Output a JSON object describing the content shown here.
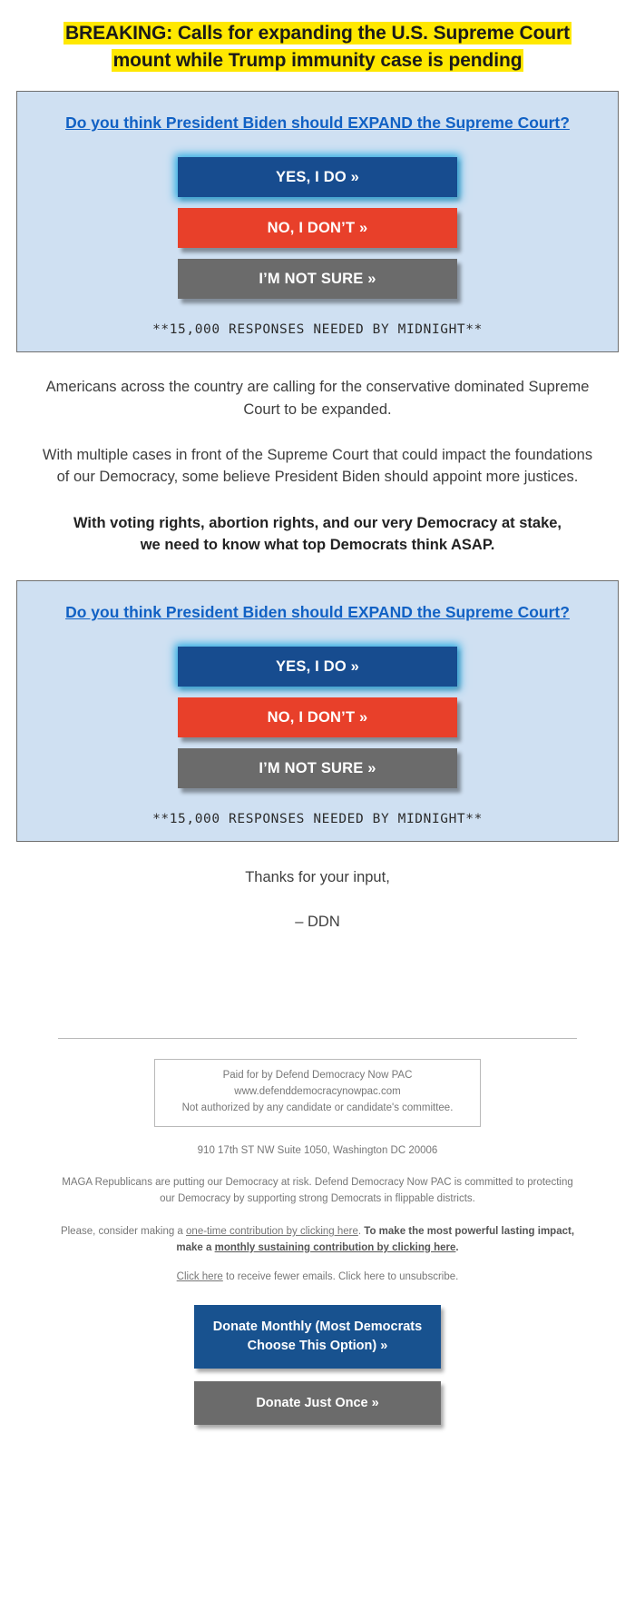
{
  "headline": {
    "line1": "BREAKING: Calls for expanding the U.S. Supreme Court",
    "line2": "mount while Trump immunity case is pending",
    "highlight_color": "#ffe800"
  },
  "poll": {
    "question": "Do you think President Biden should EXPAND the Supreme Court?",
    "question_color": "#1161c4",
    "background_color": "#cfe0f2",
    "buttons": [
      {
        "label": "YES, I DO »",
        "color": "#174c8f",
        "name": "yes"
      },
      {
        "label": "NO, I DON’T »",
        "color": "#e8402a",
        "name": "no"
      },
      {
        "label": "I’M NOT SURE »",
        "color": "#6b6b6b",
        "name": "not-sure"
      }
    ],
    "note": "**15,000 RESPONSES NEEDED BY MIDNIGHT**"
  },
  "body": {
    "para1": "Americans across the country are calling for the conservative dominated Supreme Court to be expanded.",
    "para2": "With multiple cases in front of the Supreme Court that could impact the foundations of our Democracy, some believe President Biden should appoint more justices.",
    "para3_bold": "With voting rights, abortion rights, and our very Democracy at stake, we need to know what top Democrats think ASAP.",
    "closing": "Thanks for your input,",
    "signoff": "– DDN"
  },
  "footer": {
    "disclaimer": {
      "line1": "Paid for by Defend Democracy Now PAC",
      "line2": "www.defenddemocracynowpac.com",
      "line3": "Not authorized by any candidate or candidate's committee."
    },
    "address": "910 17th ST NW Suite 1050, Washington DC 20006",
    "mission": "MAGA Republicans are putting our Democracy at risk. Defend Democracy Now PAC is committed to protecting our Democracy by supporting strong Democrats in flippable districts.",
    "ask_prefix": "Please, consider making a ",
    "ask_link_onetime": "one-time contribution by clicking here",
    "ask_middle": ". ",
    "ask_bold_prefix": "To make the most powerful lasting impact, make a ",
    "ask_bold_link": "monthly sustaining contribution by clicking here",
    "ask_bold_suffix": ".",
    "unsub_link": "Click here",
    "unsub_rest": " to receive fewer emails. Click here to unsubscribe.",
    "donate_monthly": "Donate Monthly (Most Democrats Choose This Option) »",
    "donate_once": "Donate Just Once »"
  }
}
